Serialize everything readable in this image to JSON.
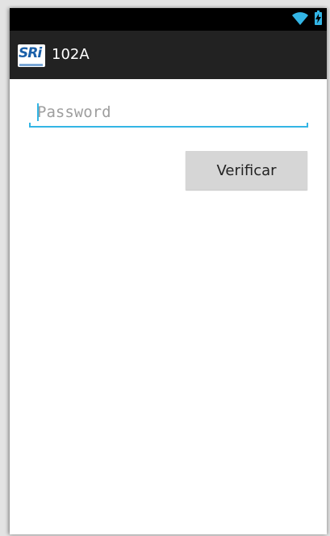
{
  "app": {
    "title": "102A",
    "logo_text": "SRi",
    "logo_icon": "sri-logo-icon"
  },
  "status_bar": {
    "icons": [
      "wifi-icon",
      "battery-charging-icon"
    ],
    "accent_color": "#33b5e5"
  },
  "form": {
    "password_placeholder": "Password",
    "password_value": "",
    "verify_label": "Verificar"
  },
  "colors": {
    "action_bar": "#222222",
    "status_bar": "#000000",
    "accent": "#33b5e5",
    "button": "#d6d6d6"
  }
}
